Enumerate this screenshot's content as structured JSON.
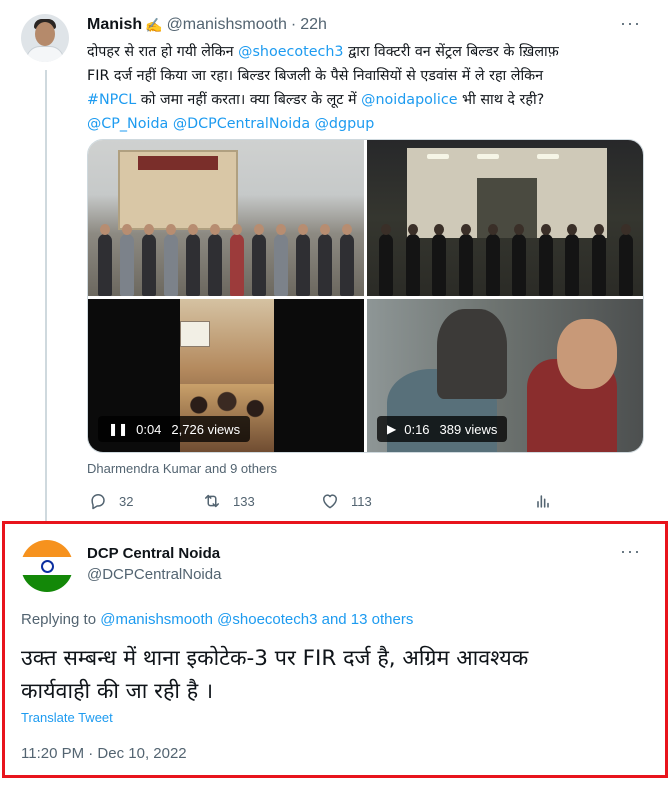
{
  "tweet1": {
    "author_name": "Manish",
    "author_emoji": "✍️",
    "handle": "@manishsmooth",
    "separator": "·",
    "time": "22h",
    "more": "···",
    "text_lines": [
      [
        {
          "t": "दोपहर से रात हो गयी लेकिन ",
          "link": false
        },
        {
          "t": "@shoecotech3",
          "link": true
        },
        {
          "t": " द्वारा विक्टरी वन सेंट्रल बिल्डर के ख़िलाफ़",
          "link": false
        }
      ],
      [
        {
          "t": "FIR दर्ज नहीं किया जा रहा। बिल्डर बिजली के पैसे निवासियों से एडवांस में ले रहा लेकिन",
          "link": false
        }
      ],
      [
        {
          "t": "#NPCL",
          "link": true
        },
        {
          "t": " को जमा नहीं करता। क्या बिल्डर के लूट में ",
          "link": false
        },
        {
          "t": "@noidapolice",
          "link": true
        },
        {
          "t": " भी साथ दे रही?",
          "link": false
        }
      ],
      [
        {
          "t": "@CP_Noida",
          "link": true
        },
        {
          "t": " ",
          "link": false
        },
        {
          "t": "@DCPCentralNoida",
          "link": true
        },
        {
          "t": " ",
          "link": false
        },
        {
          "t": "@dgpup",
          "link": true
        }
      ]
    ],
    "videos": [
      {
        "control": "❚❚",
        "duration": "0:04",
        "views": "2,726 views"
      },
      {
        "control": "▶",
        "duration": "0:16",
        "views": "389 views"
      }
    ],
    "tagged": "Dharmendra Kumar and 9 others",
    "stats": {
      "replies": "32",
      "retweets": "133",
      "likes": "113"
    }
  },
  "tweet2": {
    "author_name": "DCP Central Noida",
    "handle": "@DCPCentralNoida",
    "more": "···",
    "replying_prefix": "Replying to ",
    "replying_to": "@manishsmooth @shoecotech3 and 13 others",
    "text_lines": [
      "उक्त सम्बन्ध में थाना इकोटेक-3 पर FIR दर्ज है, अग्रिम आवश्यक",
      "कार्यवाही की जा रही है ।"
    ],
    "translate": "Translate Tweet",
    "timestamp": "11:20 PM · Dec 10, 2022"
  },
  "colors": {
    "link": "#1d9bf0",
    "muted": "#536471",
    "highlight_border": "#e8141c"
  }
}
